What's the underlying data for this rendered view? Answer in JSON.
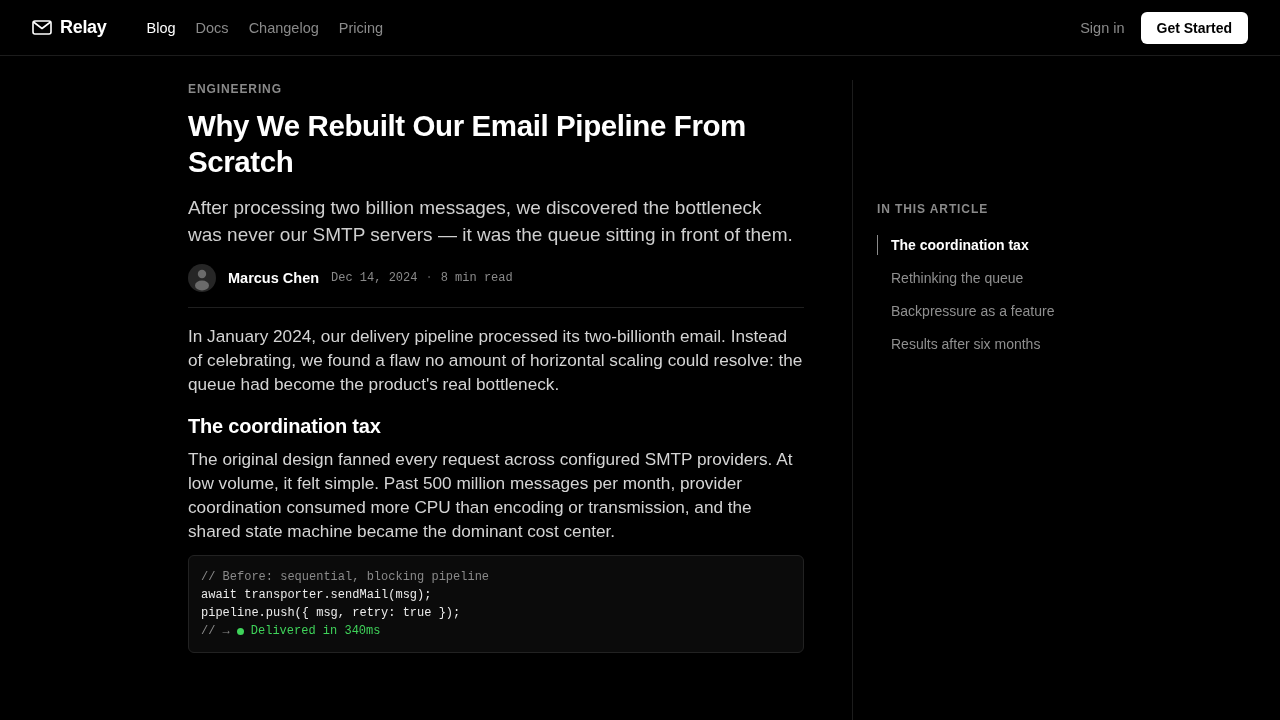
{
  "header": {
    "brand": "Relay",
    "nav": [
      {
        "label": "Blog",
        "selected": true
      },
      {
        "label": "Docs",
        "selected": false
      },
      {
        "label": "Changelog",
        "selected": false
      },
      {
        "label": "Pricing",
        "selected": false
      }
    ],
    "sign_in": "Sign in",
    "cta": "Get Started"
  },
  "article": {
    "category": "ENGINEERING",
    "title": "Why We Rebuilt Our Email Pipeline From Scratch",
    "subtitle": "After processing two billion messages, we discovered the bottleneck was never our SMTP servers — it was the queue sitting in front of them.",
    "author": "Marcus Chen",
    "date": "Dec 14, 2024",
    "separator": "·",
    "read_time": "8 min read",
    "body": [
      {
        "kind": "paragraph",
        "text": "In January 2024, our delivery pipeline processed its two-billionth email. Instead of celebrating, we found a flaw no amount of horizontal scaling could resolve: the queue had become the product's real bottleneck."
      },
      {
        "kind": "heading",
        "text": "The coordination tax"
      },
      {
        "kind": "paragraph",
        "text": "The original design fanned every request across configured SMTP providers. At low volume, it felt simple. Past 500 million messages per month, provider coordination consumed more CPU than encoding or transmission, and the shared state machine became the dominant cost center."
      },
      {
        "kind": "code",
        "lines": [
          {
            "kind": "comment",
            "text": "// Before: sequential, blocking pipeline"
          },
          {
            "kind": "code",
            "text": "await transporter.sendMail(msg);"
          },
          {
            "kind": "code",
            "text": "pipeline.push({ msg, retry: true });"
          },
          {
            "kind": "result",
            "prefix": "// →",
            "text": "Delivered in 340ms"
          }
        ]
      }
    ]
  },
  "toc": {
    "title": "IN THIS ARTICLE",
    "items": [
      {
        "label": "The coordination tax",
        "selected": true
      },
      {
        "label": "Rethinking the queue",
        "selected": false
      },
      {
        "label": "Backpressure as a feature",
        "selected": false
      },
      {
        "label": "Results after six months",
        "selected": false
      }
    ]
  }
}
